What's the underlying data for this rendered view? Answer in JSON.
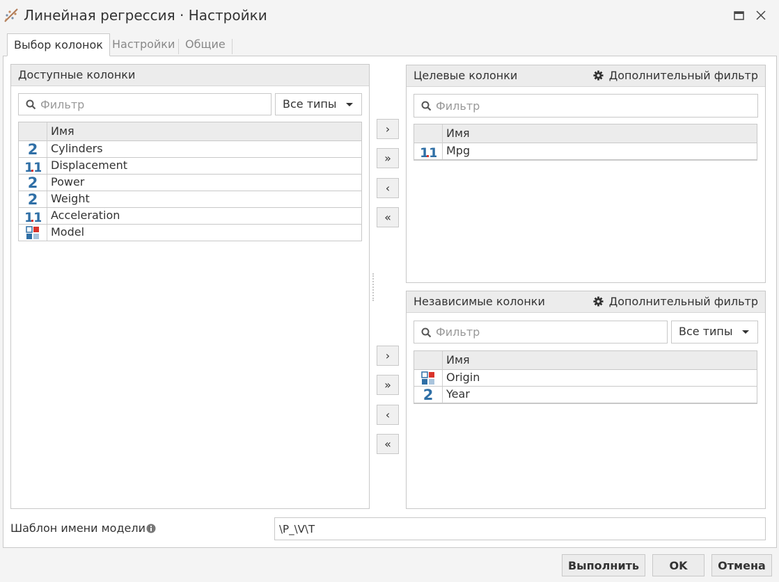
{
  "window": {
    "title": "Линейная регрессия · Настройки"
  },
  "tabs": [
    {
      "label": "Выбор колонок",
      "active": true
    },
    {
      "label": "Настройки",
      "active": false
    },
    {
      "label": "Общие",
      "active": false
    }
  ],
  "available": {
    "title": "Доступные колонки",
    "filter_placeholder": "Фильтр",
    "type_select": "Все типы",
    "column_header": "Имя",
    "rows": [
      {
        "name": "Cylinders",
        "type_icon": "integer-type-icon"
      },
      {
        "name": "Displacement",
        "type_icon": "float-type-icon"
      },
      {
        "name": "Power",
        "type_icon": "integer-type-icon"
      },
      {
        "name": "Weight",
        "type_icon": "integer-type-icon"
      },
      {
        "name": "Acceleration",
        "type_icon": "float-type-icon"
      },
      {
        "name": "Model",
        "type_icon": "categorical-type-icon"
      }
    ]
  },
  "target": {
    "title": "Целевые колонки",
    "extra_filter": "Дополнительный фильтр",
    "filter_placeholder": "Фильтр",
    "column_header": "Имя",
    "rows": [
      {
        "name": "Mpg",
        "type_icon": "float-type-icon"
      }
    ]
  },
  "independent": {
    "title": "Независимые колонки",
    "extra_filter": "Дополнительный фильтр",
    "filter_placeholder": "Фильтр",
    "type_select": "Все типы",
    "column_header": "Имя",
    "rows": [
      {
        "name": "Origin",
        "type_icon": "categorical-type-icon"
      },
      {
        "name": "Year",
        "type_icon": "integer-type-icon"
      }
    ]
  },
  "move_buttons": {
    "add": "›",
    "add_all": "»",
    "remove": "‹",
    "remove_all": "«"
  },
  "model_template": {
    "label": "Шаблон имени модели",
    "value": "\\P_\\V\\T"
  },
  "footer": {
    "run": "Выполнить",
    "ok": "OK",
    "cancel": "Отмена"
  },
  "colors": {
    "integer_icon": "#2f6fa6",
    "float_icon_dot": "#d9342b",
    "categorical_blue": "#2f6fa6",
    "categorical_red": "#d9342b",
    "categorical_light": "#a9c4dc"
  }
}
